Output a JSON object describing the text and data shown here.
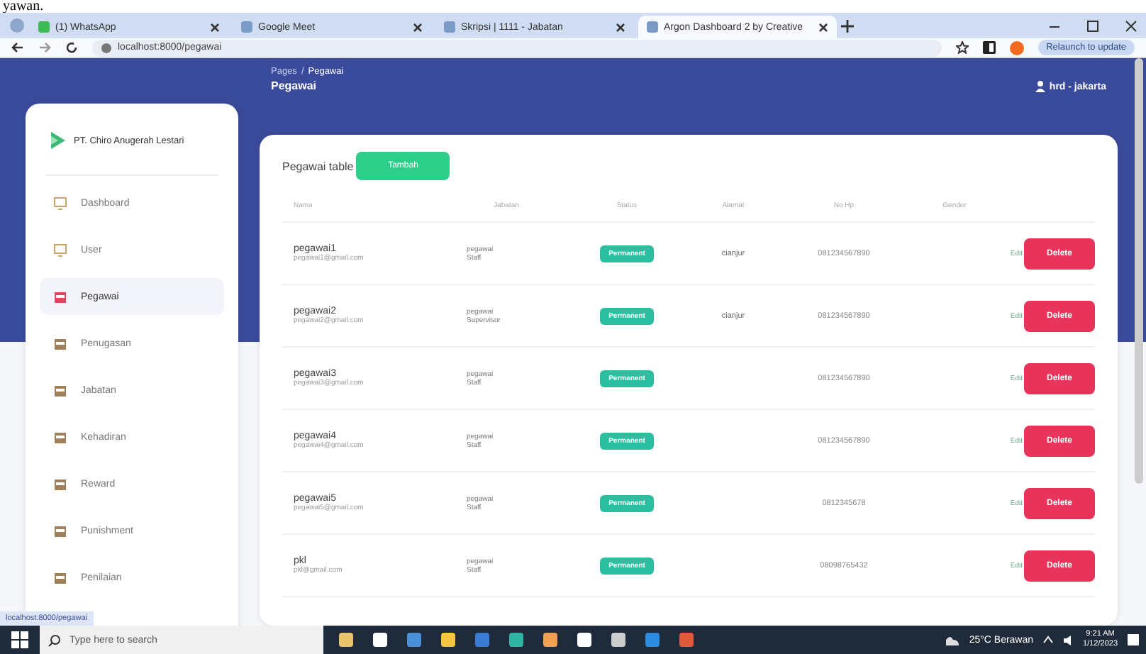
{
  "caption_fragment": "yawan.",
  "browser": {
    "tabs": [
      {
        "label": "(1) WhatsApp",
        "selected": false
      },
      {
        "label": "Google Meet",
        "selected": false
      },
      {
        "label": "Skripsi | 1111 - Jabatan",
        "selected": false
      },
      {
        "label": "Argon Dashboard 2 by Creative",
        "selected": true
      }
    ],
    "address": "localhost:8000/pegawai",
    "update_button": "Relaunch to update",
    "status_url": "localhost:8000/pegawai"
  },
  "sidebar": {
    "brand": "PT. Chiro Anugerah Lestari",
    "items": [
      {
        "label": "Dashboard",
        "selected": false
      },
      {
        "label": "User",
        "selected": false
      },
      {
        "label": "Pegawai",
        "selected": true
      },
      {
        "label": "Penugasan",
        "selected": false
      },
      {
        "label": "Jabatan",
        "selected": false
      },
      {
        "label": "Kehadiran",
        "selected": false
      },
      {
        "label": "Reward",
        "selected": false
      },
      {
        "label": "Punishment",
        "selected": false
      },
      {
        "label": "Penilaian",
        "selected": false
      }
    ]
  },
  "header": {
    "breadcrumb_root": "Pages",
    "breadcrumb_separator": "/",
    "breadcrumb_current": "Pegawai",
    "title": "Pegawai",
    "user": "hrd - jakarta"
  },
  "table": {
    "title": "Pegawai table",
    "add_button": "Tambah",
    "columns": [
      "Nama",
      "Jabatan",
      "Status",
      "Alamat",
      "No Hp",
      "Gender"
    ],
    "rows": [
      {
        "name": "pegawai1",
        "email": "pegawai1@gmail.com",
        "position": [
          "pegawai",
          "Staff"
        ],
        "status": "Permanent",
        "address": "cianjur",
        "phone": "081234567890",
        "edit": "Edit",
        "delete": "Delete"
      },
      {
        "name": "pegawai2",
        "email": "pegawai2@gmail.com",
        "position": [
          "pegawai",
          "Supervisor"
        ],
        "status": "Permanent",
        "address": "cianjur",
        "phone": "081234567890",
        "edit": "Edit",
        "delete": "Delete"
      },
      {
        "name": "pegawai3",
        "email": "pegawai3@gmail.com",
        "position": [
          "pegawai",
          "Staff"
        ],
        "status": "Permanent",
        "phone": "081234567890",
        "edit": "Edit",
        "delete": "Delete"
      },
      {
        "name": "pegawai4",
        "email": "pegawai4@gmail.com",
        "position": [
          "pegawai",
          "Staff"
        ],
        "status": "Permanent",
        "phone": "081234567890",
        "edit": "Edit",
        "delete": "Delete"
      },
      {
        "name": "pegawai5",
        "email": "pegawai5@gmail.com",
        "position": [
          "pegawai",
          "Staff"
        ],
        "status": "Permanent",
        "phone": "0812345678",
        "edit": "Edit",
        "delete": "Delete"
      },
      {
        "name": "pkl",
        "email": "pkl@gmail.com",
        "position": [
          "pegawai",
          "Staff"
        ],
        "status": "Permanent",
        "phone": "08098765432",
        "edit": "Edit",
        "delete": "Delete"
      }
    ]
  },
  "taskbar": {
    "search_placeholder": "Type here to search",
    "weather": "25°C Berawan",
    "time": "9:21 AM",
    "date": "1/12/2023"
  }
}
